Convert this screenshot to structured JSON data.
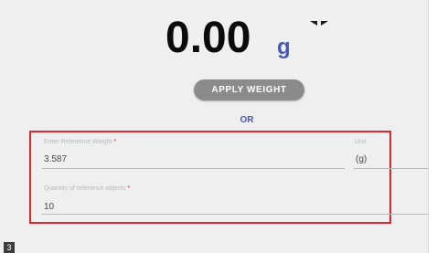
{
  "weight": {
    "value": "0.00",
    "unit": "g"
  },
  "icons": {
    "unit_dropdown": "unit-dropdown-icon"
  },
  "actions": {
    "apply_weight_label": "APPLY WEIGHT",
    "or_label": "OR"
  },
  "form": {
    "reference_weight": {
      "label": "Enter Reference Weight",
      "required_mark": "*",
      "value": "3.587"
    },
    "unit": {
      "label": "Unit",
      "value": "(g)"
    },
    "quantity": {
      "label": "Quantity of reference objects",
      "required_mark": "*",
      "value": "10"
    }
  },
  "figure": {
    "step_number": "3"
  },
  "colors": {
    "accent": "#4b58b8",
    "highlight_border": "#e0262a",
    "button_bg": "#8b8b8b"
  }
}
